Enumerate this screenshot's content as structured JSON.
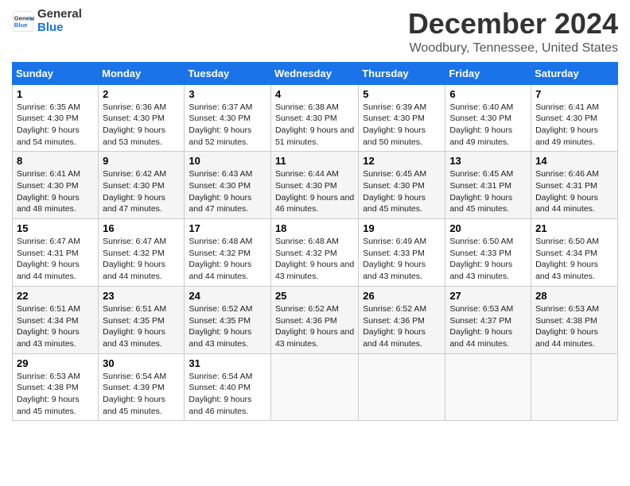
{
  "header": {
    "logo_line1": "General",
    "logo_line2": "Blue",
    "month_title": "December 2024",
    "location": "Woodbury, Tennessee, United States"
  },
  "days_of_week": [
    "Sunday",
    "Monday",
    "Tuesday",
    "Wednesday",
    "Thursday",
    "Friday",
    "Saturday"
  ],
  "weeks": [
    [
      {
        "day": "1",
        "sunrise": "6:35 AM",
        "sunset": "4:30 PM",
        "daylight": "9 hours and 54 minutes."
      },
      {
        "day": "2",
        "sunrise": "6:36 AM",
        "sunset": "4:30 PM",
        "daylight": "9 hours and 53 minutes."
      },
      {
        "day": "3",
        "sunrise": "6:37 AM",
        "sunset": "4:30 PM",
        "daylight": "9 hours and 52 minutes."
      },
      {
        "day": "4",
        "sunrise": "6:38 AM",
        "sunset": "4:30 PM",
        "daylight": "9 hours and 51 minutes."
      },
      {
        "day": "5",
        "sunrise": "6:39 AM",
        "sunset": "4:30 PM",
        "daylight": "9 hours and 50 minutes."
      },
      {
        "day": "6",
        "sunrise": "6:40 AM",
        "sunset": "4:30 PM",
        "daylight": "9 hours and 49 minutes."
      },
      {
        "day": "7",
        "sunrise": "6:41 AM",
        "sunset": "4:30 PM",
        "daylight": "9 hours and 49 minutes."
      }
    ],
    [
      {
        "day": "8",
        "sunrise": "6:41 AM",
        "sunset": "4:30 PM",
        "daylight": "9 hours and 48 minutes."
      },
      {
        "day": "9",
        "sunrise": "6:42 AM",
        "sunset": "4:30 PM",
        "daylight": "9 hours and 47 minutes."
      },
      {
        "day": "10",
        "sunrise": "6:43 AM",
        "sunset": "4:30 PM",
        "daylight": "9 hours and 47 minutes."
      },
      {
        "day": "11",
        "sunrise": "6:44 AM",
        "sunset": "4:30 PM",
        "daylight": "9 hours and 46 minutes."
      },
      {
        "day": "12",
        "sunrise": "6:45 AM",
        "sunset": "4:30 PM",
        "daylight": "9 hours and 45 minutes."
      },
      {
        "day": "13",
        "sunrise": "6:45 AM",
        "sunset": "4:31 PM",
        "daylight": "9 hours and 45 minutes."
      },
      {
        "day": "14",
        "sunrise": "6:46 AM",
        "sunset": "4:31 PM",
        "daylight": "9 hours and 44 minutes."
      }
    ],
    [
      {
        "day": "15",
        "sunrise": "6:47 AM",
        "sunset": "4:31 PM",
        "daylight": "9 hours and 44 minutes."
      },
      {
        "day": "16",
        "sunrise": "6:47 AM",
        "sunset": "4:32 PM",
        "daylight": "9 hours and 44 minutes."
      },
      {
        "day": "17",
        "sunrise": "6:48 AM",
        "sunset": "4:32 PM",
        "daylight": "9 hours and 44 minutes."
      },
      {
        "day": "18",
        "sunrise": "6:48 AM",
        "sunset": "4:32 PM",
        "daylight": "9 hours and 43 minutes."
      },
      {
        "day": "19",
        "sunrise": "6:49 AM",
        "sunset": "4:33 PM",
        "daylight": "9 hours and 43 minutes."
      },
      {
        "day": "20",
        "sunrise": "6:50 AM",
        "sunset": "4:33 PM",
        "daylight": "9 hours and 43 minutes."
      },
      {
        "day": "21",
        "sunrise": "6:50 AM",
        "sunset": "4:34 PM",
        "daylight": "9 hours and 43 minutes."
      }
    ],
    [
      {
        "day": "22",
        "sunrise": "6:51 AM",
        "sunset": "4:34 PM",
        "daylight": "9 hours and 43 minutes."
      },
      {
        "day": "23",
        "sunrise": "6:51 AM",
        "sunset": "4:35 PM",
        "daylight": "9 hours and 43 minutes."
      },
      {
        "day": "24",
        "sunrise": "6:52 AM",
        "sunset": "4:35 PM",
        "daylight": "9 hours and 43 minutes."
      },
      {
        "day": "25",
        "sunrise": "6:52 AM",
        "sunset": "4:36 PM",
        "daylight": "9 hours and 43 minutes."
      },
      {
        "day": "26",
        "sunrise": "6:52 AM",
        "sunset": "4:36 PM",
        "daylight": "9 hours and 44 minutes."
      },
      {
        "day": "27",
        "sunrise": "6:53 AM",
        "sunset": "4:37 PM",
        "daylight": "9 hours and 44 minutes."
      },
      {
        "day": "28",
        "sunrise": "6:53 AM",
        "sunset": "4:38 PM",
        "daylight": "9 hours and 44 minutes."
      }
    ],
    [
      {
        "day": "29",
        "sunrise": "6:53 AM",
        "sunset": "4:38 PM",
        "daylight": "9 hours and 45 minutes."
      },
      {
        "day": "30",
        "sunrise": "6:54 AM",
        "sunset": "4:39 PM",
        "daylight": "9 hours and 45 minutes."
      },
      {
        "day": "31",
        "sunrise": "6:54 AM",
        "sunset": "4:40 PM",
        "daylight": "9 hours and 46 minutes."
      },
      null,
      null,
      null,
      null
    ]
  ],
  "labels": {
    "sunrise": "Sunrise:",
    "sunset": "Sunset:",
    "daylight": "Daylight:"
  }
}
